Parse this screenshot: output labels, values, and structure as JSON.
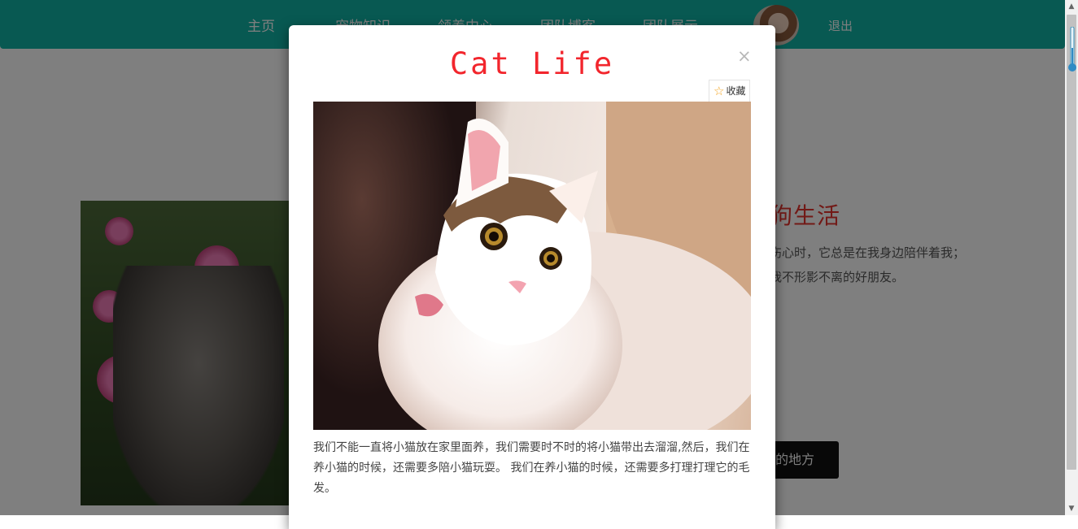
{
  "nav": {
    "items": [
      {
        "label": "主页"
      },
      {
        "label": "宠物知识"
      },
      {
        "label": "领养中心"
      },
      {
        "label": "团队博客"
      },
      {
        "label": "团队展示"
      }
    ],
    "logout": "退出",
    "color": "#11b3a5"
  },
  "background_section": {
    "title": "狗生活",
    "text_line1": "伤心时，它总是在我身边陪伴着我；",
    "text_line2": "我不形影不离的好朋友。",
    "button_label": "的地方"
  },
  "modal": {
    "title": "Cat Life",
    "title_color": "#f2262d",
    "close_symbol": "×",
    "favorite_label": "收藏",
    "favorite_icon": "star-icon",
    "paragraph": "我们不能一直将小猫放在家里面养，我们需要时不时的将小猫带出去溜溜,然后，我们在养小猫的时候，还需要多陪小猫玩耍。 我们在养小猫的时候，还需要多打理打理它的毛发。"
  }
}
